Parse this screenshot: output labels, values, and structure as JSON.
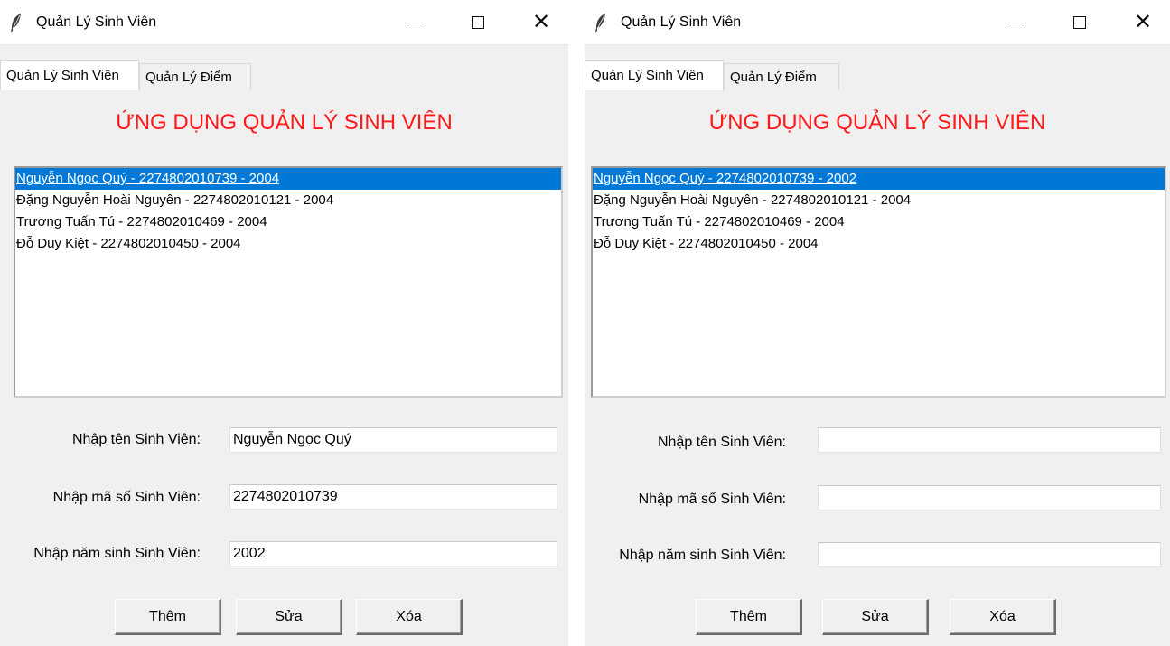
{
  "windows": [
    {
      "title": "Quản Lý Sinh Viên",
      "tabs": [
        {
          "label": "Quản Lý Sinh Viên"
        },
        {
          "label": "Quản Lý Điểm"
        }
      ],
      "heading": "ỨNG DỤNG QUẢN LÝ SINH VIÊN",
      "list_items": [
        "Nguyễn Ngọc Quý - 2274802010739 - 2004",
        "Đặng Nguyễn Hoài Nguyên - 2274802010121 - 2004",
        "Trương Tuấn Tú - 2274802010469 - 2004",
        "Đỗ Duy Kiệt - 2274802010450 - 2004"
      ],
      "selected_index": 0,
      "form": {
        "name_label": "Nhập tên Sinh Viên:",
        "name_value": "Nguyễn Ngọc Quý",
        "id_label": "Nhập mã số Sinh Viên:",
        "id_value": "2274802010739",
        "year_label": "Nhập năm sinh Sinh Viên:",
        "year_value": "2002"
      },
      "buttons": {
        "add": "Thêm",
        "edit": "Sửa",
        "delete": "Xóa"
      }
    },
    {
      "title": "Quản Lý Sinh Viên",
      "tabs": [
        {
          "label": "Quản Lý Sinh Viên"
        },
        {
          "label": "Quản Lý Điểm"
        }
      ],
      "heading": "ỨNG DỤNG QUẢN LÝ SINH VIÊN",
      "list_items": [
        "Nguyễn Ngọc Quý - 2274802010739 - 2002",
        "Đặng Nguyễn Hoài Nguyên - 2274802010121 - 2004",
        "Trương Tuấn Tú - 2274802010469 - 2004",
        "Đỗ Duy Kiệt - 2274802010450 - 2004"
      ],
      "selected_index": 0,
      "form": {
        "name_label": "Nhập tên Sinh Viên:",
        "name_value": "",
        "id_label": "Nhập mã số Sinh Viên:",
        "id_value": "",
        "year_label": "Nhập năm sinh Sinh Viên:",
        "year_value": ""
      },
      "buttons": {
        "add": "Thêm",
        "edit": "Sửa",
        "delete": "Xóa"
      }
    }
  ],
  "colors": {
    "heading": "#ff1a1a",
    "selection": "#0078d7",
    "window_bg": "#f0f0f0"
  },
  "icons": {
    "app": "feather-icon",
    "minimize": "minimize-icon",
    "maximize": "maximize-icon",
    "close": "close-icon"
  }
}
